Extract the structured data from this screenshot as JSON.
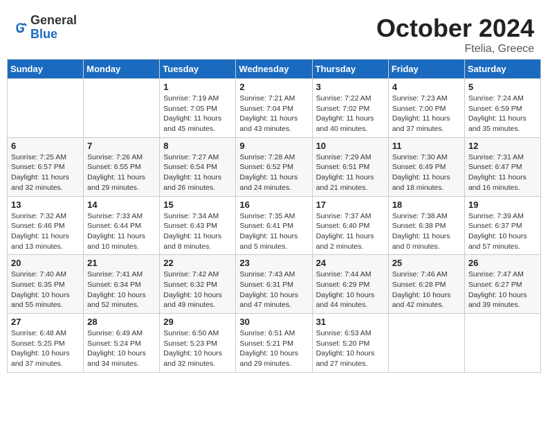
{
  "header": {
    "logo_general": "General",
    "logo_blue": "Blue",
    "title": "October 2024",
    "subtitle": "Ftelia, Greece"
  },
  "days_of_week": [
    "Sunday",
    "Monday",
    "Tuesday",
    "Wednesday",
    "Thursday",
    "Friday",
    "Saturday"
  ],
  "weeks": [
    [
      {
        "day": "",
        "info": ""
      },
      {
        "day": "",
        "info": ""
      },
      {
        "day": "1",
        "info": "Sunrise: 7:19 AM\nSunset: 7:05 PM\nDaylight: 11 hours and 45 minutes."
      },
      {
        "day": "2",
        "info": "Sunrise: 7:21 AM\nSunset: 7:04 PM\nDaylight: 11 hours and 43 minutes."
      },
      {
        "day": "3",
        "info": "Sunrise: 7:22 AM\nSunset: 7:02 PM\nDaylight: 11 hours and 40 minutes."
      },
      {
        "day": "4",
        "info": "Sunrise: 7:23 AM\nSunset: 7:00 PM\nDaylight: 11 hours and 37 minutes."
      },
      {
        "day": "5",
        "info": "Sunrise: 7:24 AM\nSunset: 6:59 PM\nDaylight: 11 hours and 35 minutes."
      }
    ],
    [
      {
        "day": "6",
        "info": "Sunrise: 7:25 AM\nSunset: 6:57 PM\nDaylight: 11 hours and 32 minutes."
      },
      {
        "day": "7",
        "info": "Sunrise: 7:26 AM\nSunset: 6:55 PM\nDaylight: 11 hours and 29 minutes."
      },
      {
        "day": "8",
        "info": "Sunrise: 7:27 AM\nSunset: 6:54 PM\nDaylight: 11 hours and 26 minutes."
      },
      {
        "day": "9",
        "info": "Sunrise: 7:28 AM\nSunset: 6:52 PM\nDaylight: 11 hours and 24 minutes."
      },
      {
        "day": "10",
        "info": "Sunrise: 7:29 AM\nSunset: 6:51 PM\nDaylight: 11 hours and 21 minutes."
      },
      {
        "day": "11",
        "info": "Sunrise: 7:30 AM\nSunset: 6:49 PM\nDaylight: 11 hours and 18 minutes."
      },
      {
        "day": "12",
        "info": "Sunrise: 7:31 AM\nSunset: 6:47 PM\nDaylight: 11 hours and 16 minutes."
      }
    ],
    [
      {
        "day": "13",
        "info": "Sunrise: 7:32 AM\nSunset: 6:46 PM\nDaylight: 11 hours and 13 minutes."
      },
      {
        "day": "14",
        "info": "Sunrise: 7:33 AM\nSunset: 6:44 PM\nDaylight: 11 hours and 10 minutes."
      },
      {
        "day": "15",
        "info": "Sunrise: 7:34 AM\nSunset: 6:43 PM\nDaylight: 11 hours and 8 minutes."
      },
      {
        "day": "16",
        "info": "Sunrise: 7:35 AM\nSunset: 6:41 PM\nDaylight: 11 hours and 5 minutes."
      },
      {
        "day": "17",
        "info": "Sunrise: 7:37 AM\nSunset: 6:40 PM\nDaylight: 11 hours and 2 minutes."
      },
      {
        "day": "18",
        "info": "Sunrise: 7:38 AM\nSunset: 6:38 PM\nDaylight: 11 hours and 0 minutes."
      },
      {
        "day": "19",
        "info": "Sunrise: 7:39 AM\nSunset: 6:37 PM\nDaylight: 10 hours and 57 minutes."
      }
    ],
    [
      {
        "day": "20",
        "info": "Sunrise: 7:40 AM\nSunset: 6:35 PM\nDaylight: 10 hours and 55 minutes."
      },
      {
        "day": "21",
        "info": "Sunrise: 7:41 AM\nSunset: 6:34 PM\nDaylight: 10 hours and 52 minutes."
      },
      {
        "day": "22",
        "info": "Sunrise: 7:42 AM\nSunset: 6:32 PM\nDaylight: 10 hours and 49 minutes."
      },
      {
        "day": "23",
        "info": "Sunrise: 7:43 AM\nSunset: 6:31 PM\nDaylight: 10 hours and 47 minutes."
      },
      {
        "day": "24",
        "info": "Sunrise: 7:44 AM\nSunset: 6:29 PM\nDaylight: 10 hours and 44 minutes."
      },
      {
        "day": "25",
        "info": "Sunrise: 7:46 AM\nSunset: 6:28 PM\nDaylight: 10 hours and 42 minutes."
      },
      {
        "day": "26",
        "info": "Sunrise: 7:47 AM\nSunset: 6:27 PM\nDaylight: 10 hours and 39 minutes."
      }
    ],
    [
      {
        "day": "27",
        "info": "Sunrise: 6:48 AM\nSunset: 5:25 PM\nDaylight: 10 hours and 37 minutes."
      },
      {
        "day": "28",
        "info": "Sunrise: 6:49 AM\nSunset: 5:24 PM\nDaylight: 10 hours and 34 minutes."
      },
      {
        "day": "29",
        "info": "Sunrise: 6:50 AM\nSunset: 5:23 PM\nDaylight: 10 hours and 32 minutes."
      },
      {
        "day": "30",
        "info": "Sunrise: 6:51 AM\nSunset: 5:21 PM\nDaylight: 10 hours and 29 minutes."
      },
      {
        "day": "31",
        "info": "Sunrise: 6:53 AM\nSunset: 5:20 PM\nDaylight: 10 hours and 27 minutes."
      },
      {
        "day": "",
        "info": ""
      },
      {
        "day": "",
        "info": ""
      }
    ]
  ]
}
